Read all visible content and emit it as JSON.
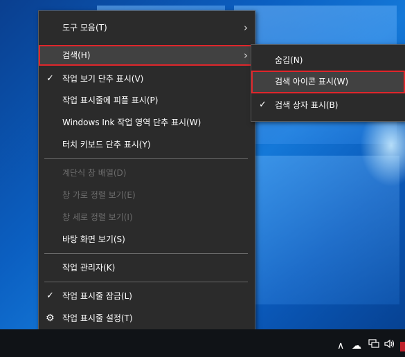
{
  "main_menu": {
    "items": [
      {
        "label": "도구 모음(T)"
      },
      {
        "label": "검색(H)"
      },
      {
        "label": "작업 보기 단추 표시(V)"
      },
      {
        "label": "작업 표시줄에 피플 표시(P)"
      },
      {
        "label": "Windows Ink 작업 영역 단추 표시(W)"
      },
      {
        "label": "터치 키보드 단추 표시(Y)"
      },
      {
        "label": "계단식 창 배열(D)"
      },
      {
        "label": "창 가로 정렬 보기(E)"
      },
      {
        "label": "창 세로 정렬 보기(I)"
      },
      {
        "label": "바탕 화면 보기(S)"
      },
      {
        "label": "작업 관리자(K)"
      },
      {
        "label": "작업 표시줄 잠금(L)"
      },
      {
        "label": "작업 표시줄 설정(T)"
      }
    ]
  },
  "sub_menu": {
    "items": [
      {
        "label": "숨김(N)"
      },
      {
        "label": "검색 아이콘 표시(W)"
      },
      {
        "label": "검색 상자 표시(B)"
      }
    ]
  },
  "glyphs": {
    "check": "✓",
    "arrow": "›",
    "gear": "⚙",
    "tray_chevron": "∧",
    "cloud": "☁",
    "speaker": "🕪"
  },
  "colors": {
    "menu_bg": "#2b2b2b",
    "highlight_bg": "#414141",
    "annotation_red": "#e0262b",
    "disabled_text": "#6d6d6d"
  }
}
